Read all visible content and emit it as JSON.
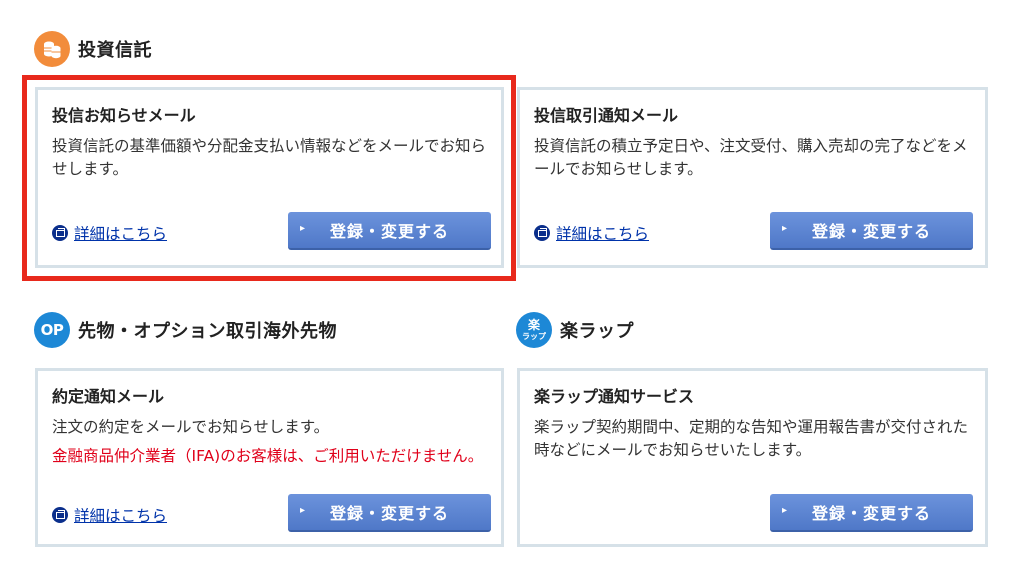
{
  "sections": [
    {
      "icon": "coins-icon",
      "title": "投資信託"
    },
    {
      "icon_text": "OP",
      "title": "先物・オプション取引海外先物"
    },
    {
      "icon_text_top": "楽",
      "icon_text_bottom": "ラップ",
      "title": "楽ラップ"
    }
  ],
  "cards": [
    {
      "title": "投信お知らせメール",
      "desc": "投資信託の基準価額や分配金支払い情報などをメールでお知らせします。",
      "link": "詳細はこちら",
      "button": "登録・変更する"
    },
    {
      "title": "投信取引通知メール",
      "desc": "投資信託の積立予定日や、注文受付、購入売却の完了などをメールでお知らせします。",
      "link": "詳細はこちら",
      "button": "登録・変更する"
    },
    {
      "title": "約定通知メール",
      "desc": "注文の約定をメールでお知らせします。",
      "note": "金融商品仲介業者（IFA)のお客様は、ご利用いただけません。",
      "link": "詳細はこちら",
      "button": "登録・変更する"
    },
    {
      "title": "楽ラップ通知サービス",
      "desc": "楽ラップ契約期間中、定期的な告知や運用報告書が交付された時などにメールでお知らせいたします。",
      "button": "登録・変更する"
    }
  ],
  "colors": {
    "accent": "#e8291c",
    "button": "#5a82d0",
    "link": "#0033aa",
    "note": "#e0001a"
  }
}
